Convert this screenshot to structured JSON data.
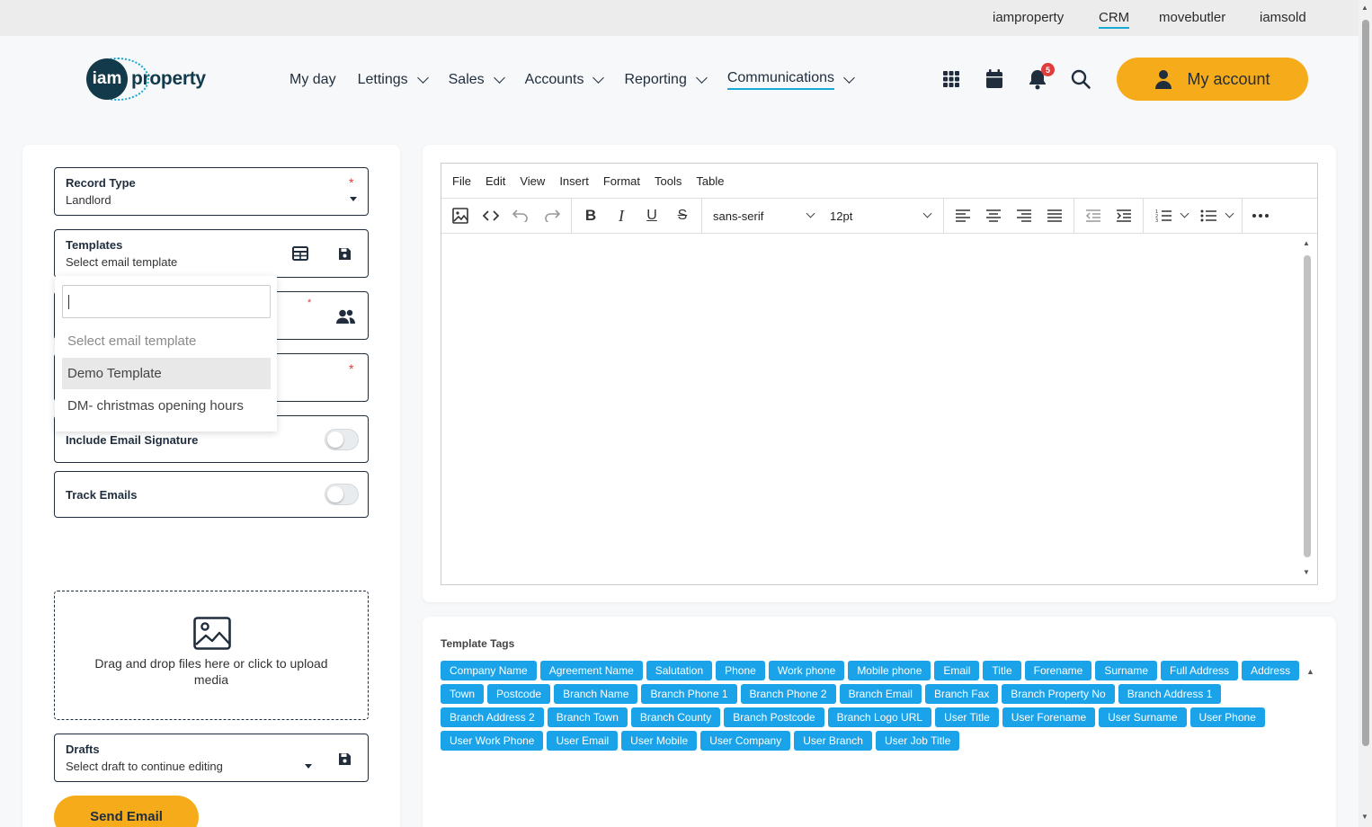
{
  "topbar": {
    "links": [
      {
        "label": "iamproperty",
        "active": false
      },
      {
        "label": "CRM",
        "active": true
      },
      {
        "label": "movebutler",
        "active": false
      },
      {
        "label": "iamsold",
        "active": false
      }
    ]
  },
  "brand": {
    "logo_circle": "iam",
    "logo_word": "property"
  },
  "nav": {
    "items": [
      {
        "label": "My day",
        "dropdown": false
      },
      {
        "label": "Lettings",
        "dropdown": true
      },
      {
        "label": "Sales",
        "dropdown": true
      },
      {
        "label": "Accounts",
        "dropdown": true
      },
      {
        "label": "Reporting",
        "dropdown": true
      },
      {
        "label": "Communications",
        "dropdown": true,
        "active": true
      }
    ]
  },
  "header_icons": {
    "apps": "grid-icon",
    "calendar": "calendar-icon",
    "notifications": "bell-icon",
    "notification_count": "5",
    "search": "search-icon"
  },
  "account_button": {
    "label": "My account",
    "icon": "user-icon"
  },
  "form": {
    "record_type": {
      "label": "Record Type",
      "value": "Landlord",
      "required": true
    },
    "templates": {
      "label": "Templates",
      "value": "Select email template"
    },
    "email_signature": {
      "label": "Include Email Signature",
      "on": false
    },
    "track_emails": {
      "label": "Track Emails",
      "on": false
    },
    "dropzone": {
      "text": "Drag and drop files here or click to upload media",
      "icon": "image-icon"
    },
    "drafts": {
      "label": "Drafts",
      "value": "Select draft to continue editing"
    },
    "send_label": "Send Email"
  },
  "template_dropdown": {
    "search_value": "",
    "options": [
      {
        "label": "Select email template",
        "placeholder": true
      },
      {
        "label": "Demo Template",
        "hover": true
      },
      {
        "label": "DM- christmas opening hours"
      }
    ]
  },
  "editor": {
    "menu": [
      "File",
      "Edit",
      "View",
      "Insert",
      "Format",
      "Tools",
      "Table"
    ],
    "font_family": "sans-serif",
    "font_size": "12pt"
  },
  "template_tags": {
    "title": "Template Tags",
    "rows": [
      [
        "Company Name",
        "Agreement Name",
        "Salutation",
        "Phone",
        "Work phone",
        "Mobile phone",
        "Email",
        "Title",
        "Forename",
        "Surname",
        "Full Address",
        "Address"
      ],
      [
        "Town",
        "Postcode",
        "Branch Name",
        "Branch Phone 1",
        "Branch Phone 2",
        "Branch Email",
        "Branch Fax",
        "Branch Property No",
        "Branch Address 1"
      ],
      [
        "Branch Address 2",
        "Branch Town",
        "Branch County",
        "Branch Postcode",
        "Branch Logo URL",
        "User Title",
        "User Forename",
        "User Surname",
        "User Phone"
      ],
      [
        "User Work Phone",
        "User Email",
        "User Mobile",
        "User Company",
        "User Branch",
        "User Job Title"
      ]
    ]
  },
  "colors": {
    "accent": "#f6ac1a",
    "tag": "#1aa3e8",
    "link_underline": "#19a9d6",
    "badge": "#e03c3c",
    "dark": "#1f2d3d"
  }
}
